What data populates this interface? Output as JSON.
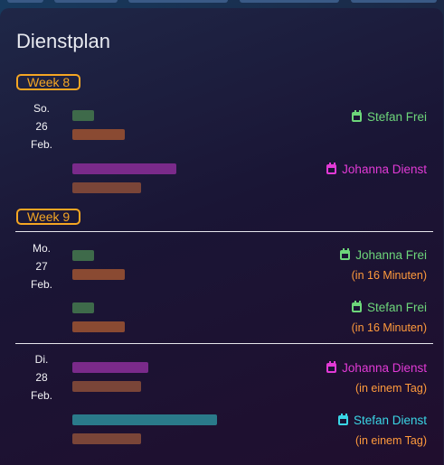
{
  "title": "Dienstplan",
  "colors": {
    "frei": "#6dd67a",
    "dienst_magenta": "#e23ad6",
    "dienst_cyan": "#3ad6e6",
    "accent_orange": "#f5a623",
    "relative_orange": "#ff9a3c"
  },
  "weeks": [
    {
      "label": "Week 8"
    },
    {
      "label": "Week 9"
    }
  ],
  "days": [
    {
      "weekday": "So.",
      "day": "26",
      "month": "Feb.",
      "events": [
        {
          "person": "Stefan Frei",
          "type": "frei",
          "relative": ""
        },
        {
          "person": "Johanna Dienst",
          "type": "dienst",
          "relative": ""
        }
      ]
    },
    {
      "weekday": "Mo.",
      "day": "27",
      "month": "Feb.",
      "events": [
        {
          "person": "Johanna Frei",
          "type": "frei",
          "relative": "(in 16 Minuten)"
        },
        {
          "person": "Stefan Frei",
          "type": "frei",
          "relative": "(in 16 Minuten)"
        }
      ]
    },
    {
      "weekday": "Di.",
      "day": "28",
      "month": "Feb.",
      "events": [
        {
          "person": "Johanna Dienst",
          "type": "dienst",
          "relative": "(in einem Tag)"
        },
        {
          "person": "Stefan Dienst",
          "type": "dienst-cyan",
          "relative": "(in einem Tag)"
        }
      ]
    }
  ]
}
